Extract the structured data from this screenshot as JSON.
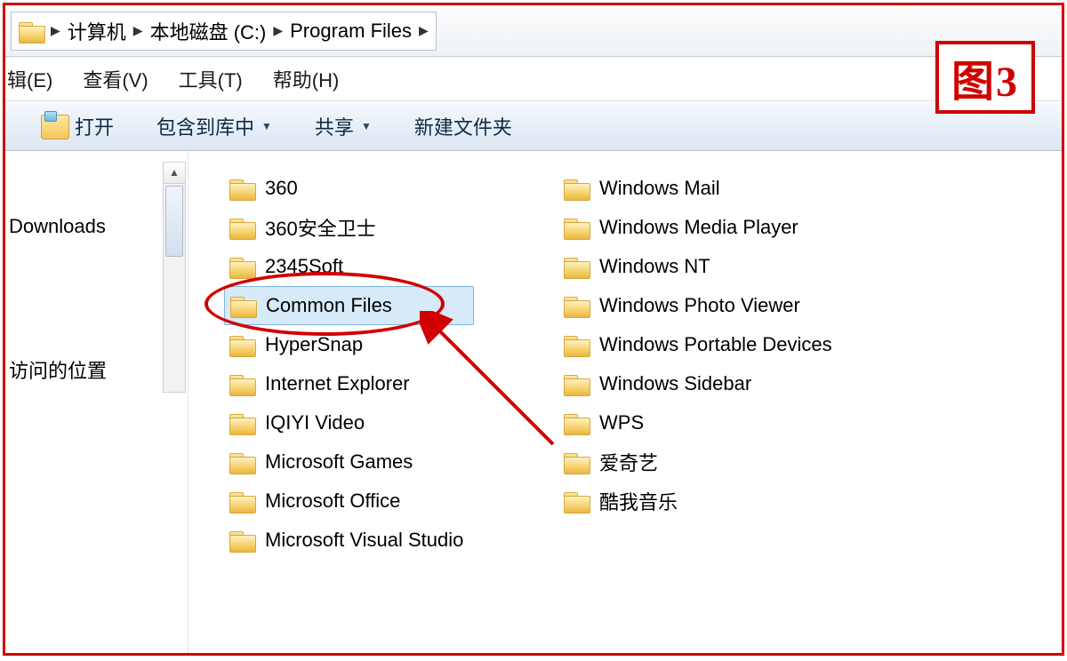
{
  "figure_label": "图3",
  "breadcrumb": {
    "parts": [
      "计算机",
      "本地磁盘 (C:)",
      "Program Files"
    ]
  },
  "menubar": {
    "items": [
      "辑(E)",
      "查看(V)",
      "工具(T)",
      "帮助(H)"
    ]
  },
  "toolbar": {
    "open": "打开",
    "include": "包含到库中",
    "share": "共享",
    "newfolder": "新建文件夹"
  },
  "nav": {
    "items": [
      "Downloads",
      "访问的位置"
    ]
  },
  "files": {
    "col1": [
      {
        "name": "360"
      },
      {
        "name": "360安全卫士"
      },
      {
        "name": "2345Soft"
      },
      {
        "name": "Common Files",
        "selected": true
      },
      {
        "name": "HyperSnap"
      },
      {
        "name": "Internet Explorer"
      },
      {
        "name": "IQIYI Video"
      },
      {
        "name": "Microsoft Games"
      },
      {
        "name": "Microsoft Office"
      },
      {
        "name": "Microsoft Visual Studio"
      }
    ],
    "col2": [
      {
        "name": "Windows Mail"
      },
      {
        "name": "Windows Media Player"
      },
      {
        "name": "Windows NT"
      },
      {
        "name": "Windows Photo Viewer"
      },
      {
        "name": "Windows Portable Devices"
      },
      {
        "name": "Windows Sidebar"
      },
      {
        "name": "WPS"
      },
      {
        "name": "爱奇艺"
      },
      {
        "name": "酷我音乐"
      }
    ]
  }
}
